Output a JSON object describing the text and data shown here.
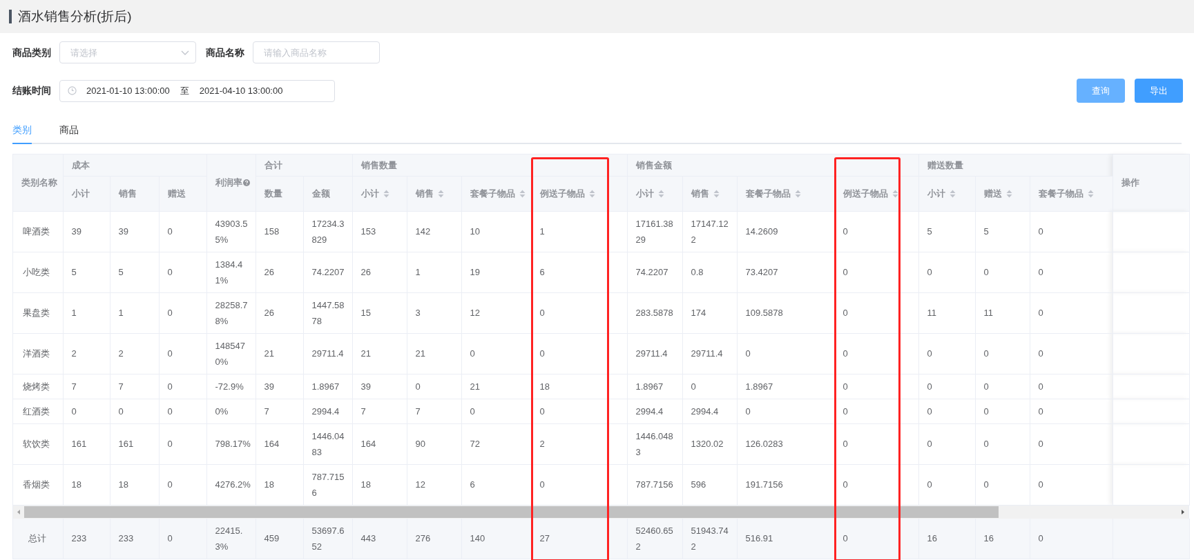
{
  "page_title": "酒水销售分析(折后)",
  "filters": {
    "category": {
      "label": "商品类别",
      "placeholder": "请选择"
    },
    "name": {
      "label": "商品名称",
      "placeholder": "请输入商品名称"
    },
    "checkout_time": {
      "label": "结账时间",
      "start": "2021-01-10 13:00:00",
      "separator": "至",
      "end": "2021-04-10 13:00:00"
    }
  },
  "buttons": [
    {
      "label": "查询",
      "kind": "light"
    },
    {
      "label": "导出",
      "kind": "primary"
    }
  ],
  "tabs": [
    {
      "label": "类别",
      "selected": true
    },
    {
      "label": "商品",
      "selected": false
    }
  ],
  "table": {
    "columns": [
      {
        "kind": "single",
        "label": "类别名称",
        "help": false
      },
      {
        "kind": "group",
        "label": "成本",
        "colspan": 3,
        "children": [
          {
            "label": "小计",
            "sortable": false,
            "highlighted": false
          },
          {
            "label": "销售",
            "sortable": false,
            "highlighted": false
          },
          {
            "label": "赠送",
            "sortable": false,
            "highlighted": false
          }
        ]
      },
      {
        "kind": "single",
        "label": "利润率",
        "help": true
      },
      {
        "kind": "group",
        "label": "合计",
        "colspan": 2,
        "children": [
          {
            "label": "数量",
            "sortable": false,
            "highlighted": false
          },
          {
            "label": "金额",
            "sortable": false,
            "highlighted": false
          }
        ]
      },
      {
        "kind": "group",
        "label": "销售数量",
        "colspan": 4,
        "children": [
          {
            "label": "小计",
            "sortable": true,
            "highlighted": false
          },
          {
            "label": "销售",
            "sortable": true,
            "highlighted": false
          },
          {
            "label": "套餐子物品",
            "sortable": true,
            "highlighted": false
          },
          {
            "label": "例送子物品",
            "sortable": true,
            "highlighted": true
          }
        ]
      },
      {
        "kind": "group",
        "label": "销售金额",
        "colspan": 4,
        "children": [
          {
            "label": "小计",
            "sortable": true,
            "highlighted": false
          },
          {
            "label": "销售",
            "sortable": true,
            "highlighted": false
          },
          {
            "label": "套餐子物品",
            "sortable": true,
            "highlighted": false
          },
          {
            "label": "例送子物品",
            "sortable": true,
            "highlighted": true
          }
        ]
      },
      {
        "kind": "group",
        "label": "赠送数量",
        "colspan": 3,
        "children": [
          {
            "label": "小计",
            "sortable": true,
            "highlighted": false
          },
          {
            "label": "赠送",
            "sortable": true,
            "highlighted": false
          },
          {
            "label": "套餐子物品",
            "sortable": true,
            "highlighted": false
          }
        ]
      }
    ],
    "action_column": "操作",
    "rows": [
      [
        "啤酒类",
        "39",
        "39",
        "0",
        "43903.55%",
        "158",
        "17234.3829",
        "153",
        "142",
        "10",
        "1",
        "17161.3829",
        "17147.122",
        "14.2609",
        "0",
        "5",
        "5",
        "0"
      ],
      [
        "小吃类",
        "5",
        "5",
        "0",
        "1384.41%",
        "26",
        "74.2207",
        "26",
        "1",
        "19",
        "6",
        "74.2207",
        "0.8",
        "73.4207",
        "0",
        "0",
        "0",
        "0"
      ],
      [
        "果盘类",
        "1",
        "1",
        "0",
        "28258.78%",
        "26",
        "1447.5878",
        "15",
        "3",
        "12",
        "0",
        "283.5878",
        "174",
        "109.5878",
        "0",
        "11",
        "11",
        "0"
      ],
      [
        "洋酒类",
        "2",
        "2",
        "0",
        "1485470%",
        "21",
        "29711.4",
        "21",
        "21",
        "0",
        "0",
        "29711.4",
        "29711.4",
        "0",
        "0",
        "0",
        "0",
        "0"
      ],
      [
        "烧烤类",
        "7",
        "7",
        "0",
        "-72.9%",
        "39",
        "1.8967",
        "39",
        "0",
        "21",
        "18",
        "1.8967",
        "0",
        "1.8967",
        "0",
        "0",
        "0",
        "0"
      ],
      [
        "红酒类",
        "0",
        "0",
        "0",
        "0%",
        "7",
        "2994.4",
        "7",
        "7",
        "0",
        "0",
        "2994.4",
        "2994.4",
        "0",
        "0",
        "0",
        "0",
        "0"
      ],
      [
        "软饮类",
        "161",
        "161",
        "0",
        "798.17%",
        "164",
        "1446.0483",
        "164",
        "90",
        "72",
        "2",
        "1446.0483",
        "1320.02",
        "126.0283",
        "0",
        "0",
        "0",
        "0"
      ],
      [
        "香烟类",
        "18",
        "18",
        "0",
        "4276.2%",
        "18",
        "787.7156",
        "18",
        "12",
        "6",
        "0",
        "787.7156",
        "596",
        "191.7156",
        "0",
        "0",
        "0",
        "0"
      ]
    ],
    "total_row": [
      "总计",
      "233",
      "233",
      "0",
      "22415.3%",
      "459",
      "53697.652",
      "443",
      "276",
      "140",
      "27",
      "52460.652",
      "51943.742",
      "516.91",
      "0",
      "16",
      "16",
      "0"
    ]
  }
}
